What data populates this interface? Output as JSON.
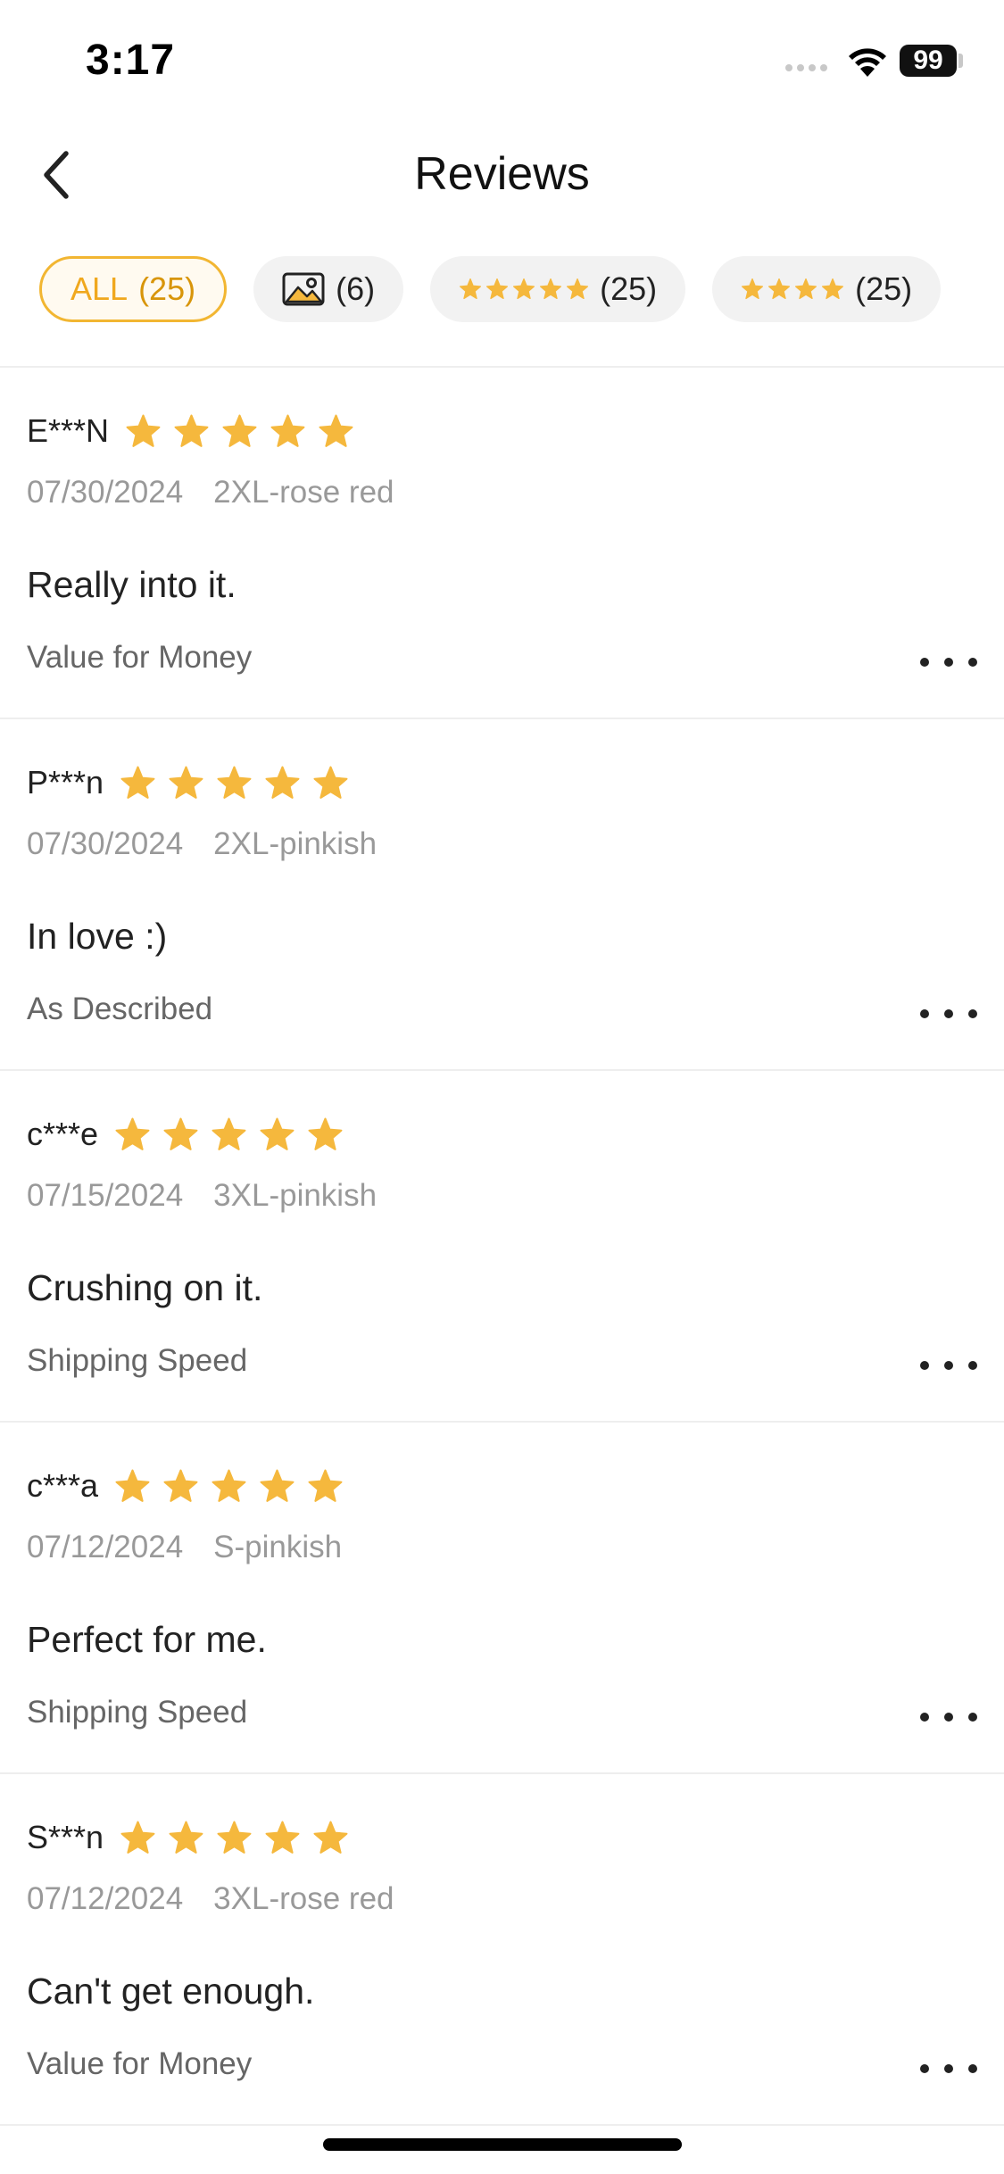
{
  "status_bar": {
    "time": "3:17",
    "battery": "99"
  },
  "nav": {
    "title": "Reviews",
    "back_icon": "chevron-left-icon"
  },
  "colors": {
    "accent": "#f2b632",
    "star": "#f5b83d",
    "divider": "#eeeeee",
    "muted_text": "#999999"
  },
  "filters": [
    {
      "id": "all",
      "label": "ALL",
      "count": "(25)",
      "active": true
    },
    {
      "id": "photos",
      "icon": "image-icon",
      "count": "(6)",
      "active": false
    },
    {
      "id": "five-star",
      "stars": 5,
      "count": "(25)",
      "active": false
    },
    {
      "id": "four-star",
      "stars": 4,
      "count": "(25)",
      "active": false
    }
  ],
  "reviews": [
    {
      "reviewer": "E***N",
      "rating": 5,
      "date": "07/30/2024",
      "variant": "2XL-rose red",
      "text": "Really into it.",
      "tag": "Value for Money"
    },
    {
      "reviewer": "P***n",
      "rating": 5,
      "date": "07/30/2024",
      "variant": "2XL-pinkish",
      "text": "In love :)",
      "tag": "As Described"
    },
    {
      "reviewer": "c***e",
      "rating": 5,
      "date": "07/15/2024",
      "variant": "3XL-pinkish",
      "text": "Crushing on it.",
      "tag": "Shipping Speed"
    },
    {
      "reviewer": "c***a",
      "rating": 5,
      "date": "07/12/2024",
      "variant": "S-pinkish",
      "text": "Perfect for me.",
      "tag": "Shipping Speed"
    },
    {
      "reviewer": "S***n",
      "rating": 5,
      "date": "07/12/2024",
      "variant": "3XL-rose red",
      "text": "Can't get enough.",
      "tag": "Value for Money"
    }
  ]
}
